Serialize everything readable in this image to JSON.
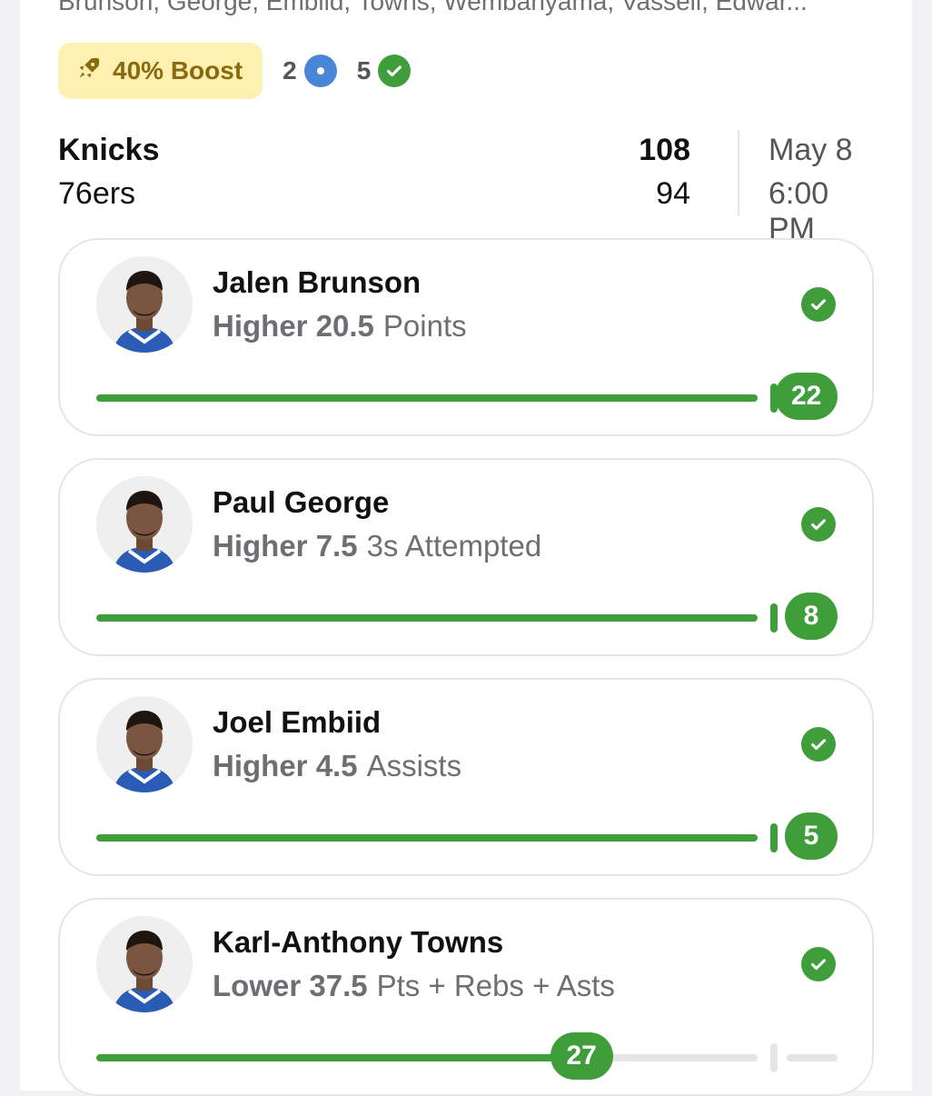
{
  "header": {
    "players_line": "Brunson, George, Embiid, Towns, Wembanyama, Vassell, Edwar..."
  },
  "badges": {
    "boost_label": "40% Boost",
    "boost_icon": "rocket-icon",
    "pending_count": "2",
    "pending_icon": "pending-dot-icon",
    "won_count": "5",
    "won_icon": "check-circle-icon"
  },
  "game": {
    "team1": "Knicks",
    "team2": "76ers",
    "score1": "108",
    "score2": "94",
    "date": "May 8",
    "time": "6:00 PM"
  },
  "colors": {
    "green": "#3f9e3a",
    "track_gray": "#e5e5e8",
    "boost_bg": "#fdf0b0",
    "boost_text": "#8a6a10",
    "pending_blue": "#4a86d8"
  },
  "picks": [
    {
      "player": "Jalen Brunson",
      "direction": "Higher",
      "line": "20.5",
      "stat": "Points",
      "result": "22",
      "status_icon": "check-circle-icon",
      "status": "won",
      "progress_to_line": 1.0
    },
    {
      "player": "Paul George",
      "direction": "Higher",
      "line": "7.5",
      "stat": "3s Attempted",
      "result": "8",
      "status_icon": "check-circle-icon",
      "status": "won",
      "progress_to_line": 1.0
    },
    {
      "player": "Joel Embiid",
      "direction": "Higher",
      "line": "4.5",
      "stat": "Assists",
      "result": "5",
      "status_icon": "check-circle-icon",
      "status": "won",
      "progress_to_line": 1.0
    },
    {
      "player": "Karl-Anthony Towns",
      "direction": "Lower",
      "line": "37.5",
      "stat": "Pts + Rebs + Asts",
      "result": "27",
      "status_icon": "check-circle-icon",
      "status": "won",
      "progress_to_line": 0.72
    }
  ]
}
